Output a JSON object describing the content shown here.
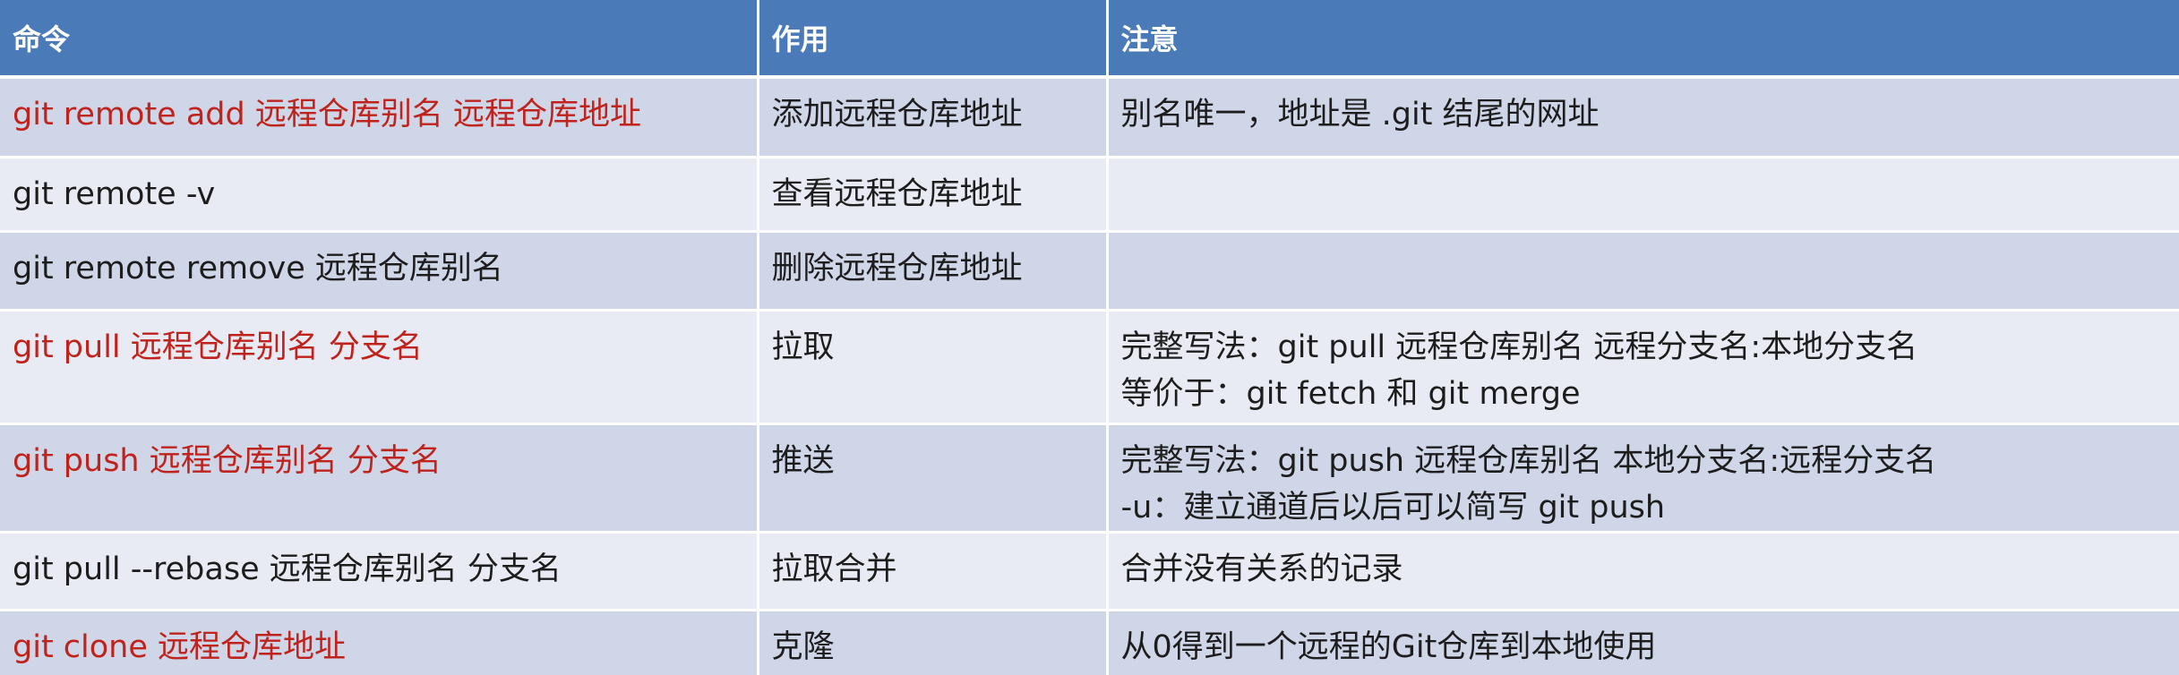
{
  "table": {
    "headers": [
      "命令",
      "作用",
      "注意"
    ],
    "rows": [
      {
        "command": "git remote add 远程仓库别名 远程仓库地址",
        "purpose": "添加远程仓库地址",
        "note_lines": [
          "别名唯一，地址是 .git 结尾的网址"
        ],
        "highlight": true
      },
      {
        "command": "git remote -v",
        "purpose": "查看远程仓库地址",
        "note_lines": [
          ""
        ],
        "highlight": false
      },
      {
        "command": "git remote remove 远程仓库别名",
        "purpose": "删除远程仓库地址",
        "note_lines": [
          ""
        ],
        "highlight": false
      },
      {
        "command": "git pull 远程仓库别名 分支名",
        "purpose": "拉取",
        "note_lines": [
          "完整写法：git pull 远程仓库别名 远程分支名:本地分支名",
          "等价于：git fetch 和 git merge"
        ],
        "highlight": true
      },
      {
        "command": "git push 远程仓库别名 分支名",
        "purpose": "推送",
        "note_lines": [
          "完整写法：git push 远程仓库别名 本地分支名:远程分支名",
          "-u：建立通道后以后可以简写 git push"
        ],
        "highlight": true
      },
      {
        "command": "git pull --rebase 远程仓库别名 分支名",
        "purpose": "拉取合并",
        "note_lines": [
          "合并没有关系的记录"
        ],
        "highlight": false
      },
      {
        "command": "git clone 远程仓库地址",
        "purpose": "克隆",
        "note_lines": [
          "从0得到一个远程的Git仓库到本地使用"
        ],
        "highlight": true
      }
    ],
    "colors": {
      "header_bg": "#4a7ab8",
      "row_odd_bg": "#cfd6e8",
      "row_even_bg": "#e8ebf3",
      "highlight_text": "#c0231c",
      "normal_text": "#1d1d1d"
    }
  }
}
